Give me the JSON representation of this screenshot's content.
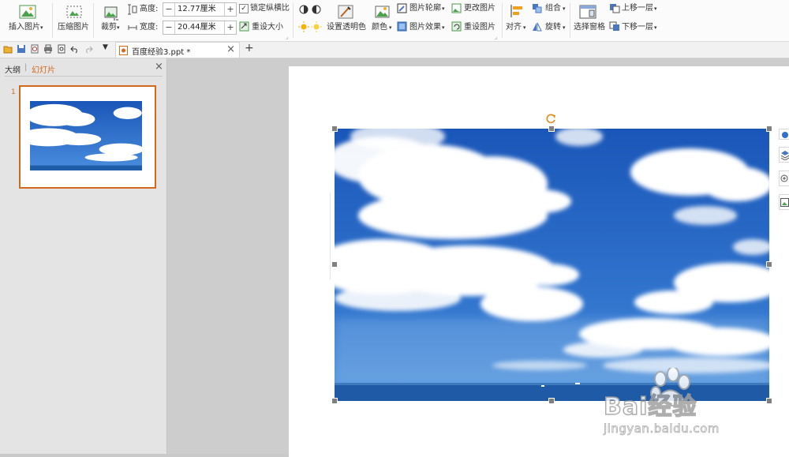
{
  "ribbon": {
    "insert_picture": "插入图片",
    "compress_picture": "压缩图片",
    "crop": "裁剪",
    "height_label": "高度:",
    "height_value": "12.77厘米",
    "width_label": "宽度:",
    "width_value": "20.44厘米",
    "lock_ratio": "锁定纵横比",
    "reset_size": "重设大小",
    "set_transparent": "设置透明色",
    "color": "颜色",
    "picture_outline": "图片轮廓",
    "picture_effects": "图片效果",
    "change_picture": "更改图片",
    "reset_picture": "重设图片",
    "align": "对齐",
    "group": "组合",
    "rotate": "旋转",
    "selection_pane": "选择窗格",
    "bring_forward": "上移一层",
    "send_backward": "下移一层",
    "minus": "−",
    "plus": "+"
  },
  "tabs": {
    "doc_title": "百度经验3.ppt *",
    "close": "×",
    "new_tab": "+"
  },
  "left_panel": {
    "outline_tab": "大纲",
    "divider": "|",
    "slides_tab": "幻灯片",
    "close": "×",
    "slide_number": "1"
  },
  "watermark": {
    "text": "Bai经验",
    "url": "jingyan.baidu.com"
  },
  "colors": {
    "accent": "#d2691e",
    "sky_top": "#1a56b8",
    "sky_bottom": "#3f86d6"
  }
}
